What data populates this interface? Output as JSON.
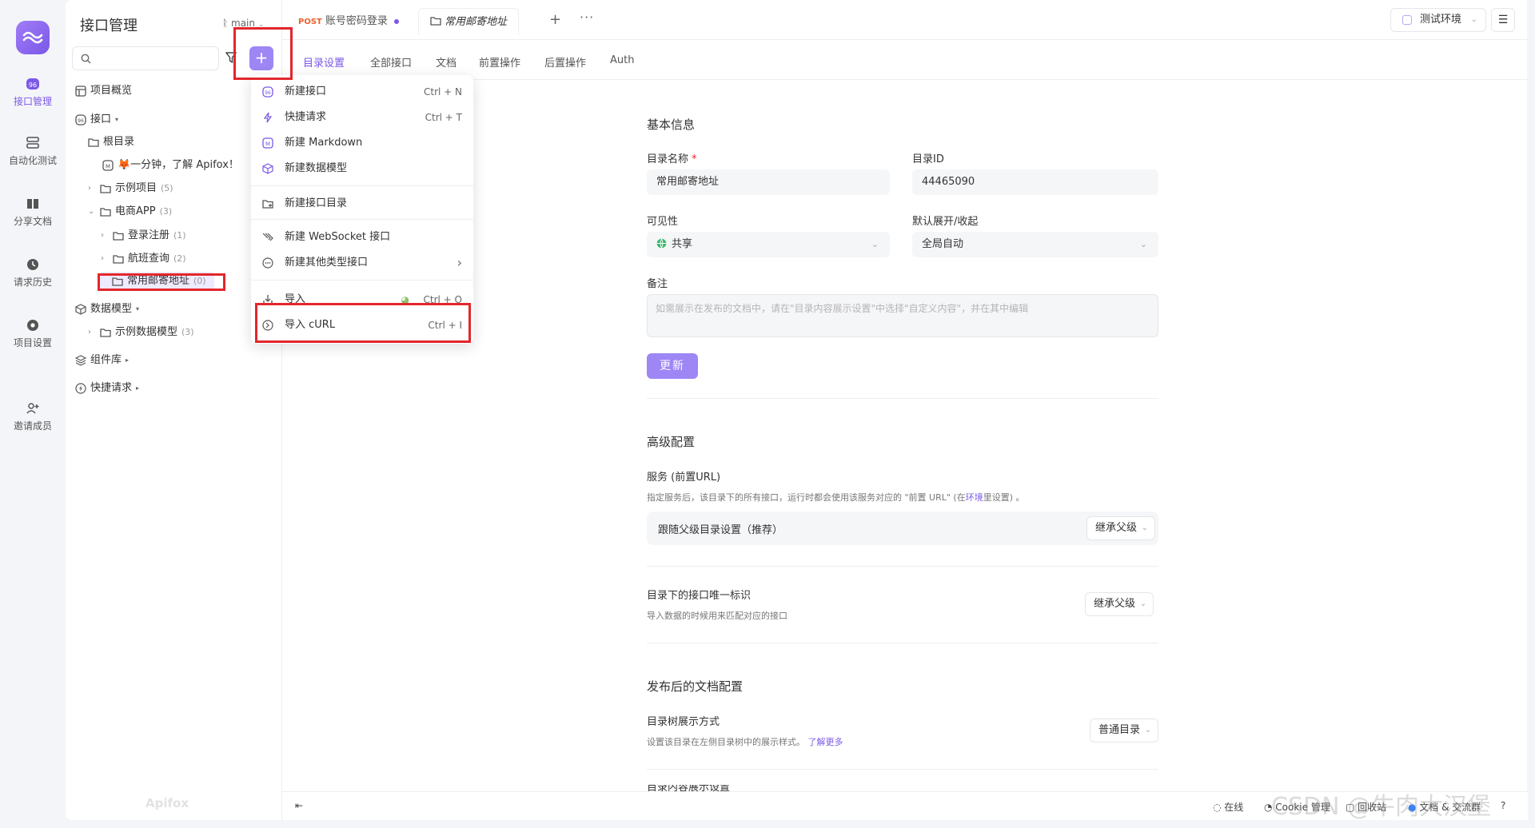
{
  "rail": {
    "items": [
      {
        "label": "接口管理"
      },
      {
        "label": "自动化测试"
      },
      {
        "label": "分享文档"
      },
      {
        "label": "请求历史"
      },
      {
        "label": "项目设置"
      },
      {
        "label": "邀请成员"
      }
    ]
  },
  "sidebar": {
    "title": "接口管理",
    "branch": "main",
    "tree": [
      {
        "label": "项目概览",
        "count": ""
      },
      {
        "label": "接口",
        "count": ""
      },
      {
        "label": "根目录",
        "count": ""
      },
      {
        "label": "🦊一分钟，了解 Apifox！",
        "count": ""
      },
      {
        "label": "示例项目",
        "count": "(5)"
      },
      {
        "label": "电商APP",
        "count": "(3)"
      },
      {
        "label": "登录注册",
        "count": "(1)"
      },
      {
        "label": "航班查询",
        "count": "(2)"
      },
      {
        "label": "常用邮寄地址",
        "count": "(0)"
      },
      {
        "label": "数据模型",
        "count": ""
      },
      {
        "label": "示例数据模型",
        "count": "(3)"
      },
      {
        "label": "组件库",
        "count": ""
      },
      {
        "label": "快捷请求",
        "count": ""
      }
    ],
    "watermark": "Apifox"
  },
  "dropdown": {
    "items": [
      {
        "label": "新建接口",
        "shortcut": "Ctrl + N"
      },
      {
        "label": "快捷请求",
        "shortcut": "Ctrl + T"
      },
      {
        "label": "新建 Markdown",
        "shortcut": ""
      },
      {
        "label": "新建数据模型",
        "shortcut": ""
      },
      {
        "label": "新建接口目录",
        "shortcut": ""
      },
      {
        "label": "新建 WebSocket 接口",
        "shortcut": ""
      },
      {
        "label": "新建其他类型接口",
        "shortcut": "›"
      },
      {
        "label": "导入",
        "shortcut": "Ctrl + O"
      },
      {
        "label": "导入 cURL",
        "shortcut": "Ctrl + I"
      }
    ]
  },
  "tabs": {
    "tab1_method": "POST",
    "tab1_label": "账号密码登录",
    "tab2_label": "常用邮寄地址",
    "plus": "+",
    "more": "···"
  },
  "env": {
    "label": "测试环境"
  },
  "subtabs": [
    "目录设置",
    "全部接口",
    "文档",
    "前置操作",
    "后置操作",
    "Auth"
  ],
  "form": {
    "basic_title": "基本信息",
    "name_label": "目录名称",
    "name_required": "*",
    "name_value": "常用邮寄地址",
    "id_label": "目录ID",
    "id_value": "44465090",
    "visibility_label": "可见性",
    "visibility_value": "共享",
    "expand_label": "默认展开/收起",
    "expand_value": "全局自动",
    "note_label": "备注",
    "note_placeholder": "如需展示在发布的文档中，请在\"目录内容展示设置\"中选择\"自定义内容\"，并在其中编辑",
    "update_button": "更新",
    "advanced_title": "高级配置",
    "service_label": "服务 (前置URL)",
    "service_hint_pre": "指定服务后，该目录下的所有接口，运行时都会使用该服务对应的 \"前置 URL\" (在",
    "service_hint_link": "环境",
    "service_hint_post": "里设置) 。",
    "service_row_label": "跟随父级目录设置（推荐）",
    "service_row_value": "继承父级",
    "unique_label": "目录下的接口唯一标识",
    "unique_hint": "导入数据的时候用来匹配对应的接口",
    "unique_value": "继承父级",
    "publish_title": "发布后的文档配置",
    "tree_mode_label": "目录树展示方式",
    "tree_mode_hint": "设置该目录在左侧目录树中的展示样式。",
    "tree_mode_link": "了解更多",
    "tree_mode_value": "普通目录",
    "cut_label": "目录内容展示设置"
  },
  "statusbar": {
    "online": "在线",
    "cookie": "Cookie 管理",
    "recycle": "回收站",
    "docs": "文档 & 交流群"
  },
  "watermark": "CSDN @牛肉大汉堡",
  "colors": {
    "accent": "#7b58e8",
    "accent_light": "#9e86f5",
    "annotation": "#e3262c",
    "post": "#e8632c"
  }
}
